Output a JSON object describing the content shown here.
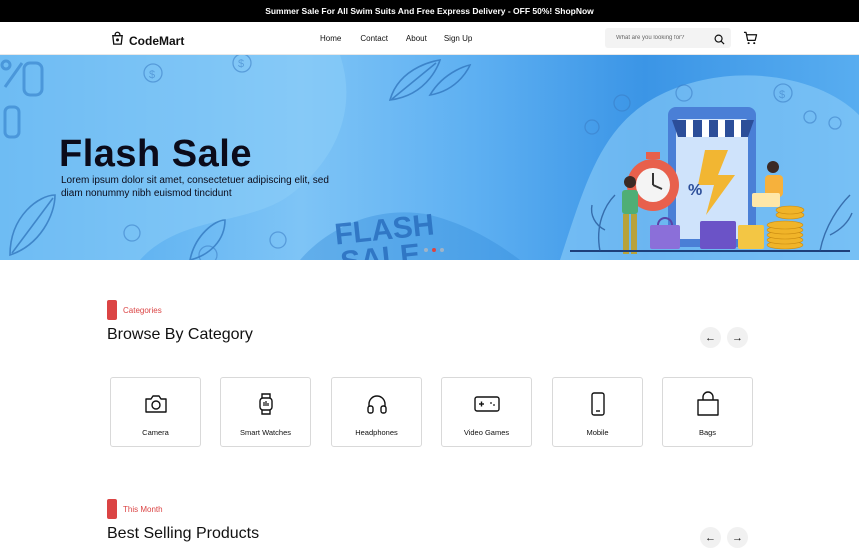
{
  "topbar": {
    "text": "Summer Sale For All Swim Suits And Free Express Delivery - OFF 50%! ShopNow"
  },
  "header": {
    "brand": "CodeMart",
    "nav": [
      "Home",
      "Contact",
      "About",
      "Sign Up"
    ],
    "search_placeholder": "What are you looking for?"
  },
  "hero": {
    "title": "Flash Sale",
    "subtitle": "Lorem ipsum dolor sit amet, consectetuer adipiscing elit, sed diam nonummy nibh euismod tincidunt",
    "illustration_text": "FLASH SALE",
    "active_slide": 2,
    "slides": 3
  },
  "categories": {
    "tag": "Categories",
    "title": "Browse By Category",
    "items": [
      {
        "label": "Camera",
        "icon": "camera-icon"
      },
      {
        "label": "Smart Watches",
        "icon": "smartwatch-icon"
      },
      {
        "label": "Headphones",
        "icon": "headphones-icon"
      },
      {
        "label": "Video Games",
        "icon": "gamepad-icon"
      },
      {
        "label": "Mobile",
        "icon": "phone-icon"
      },
      {
        "label": "Bags",
        "icon": "bag-icon"
      }
    ]
  },
  "best_selling": {
    "tag": "This Month",
    "title": "Best Selling Products"
  },
  "colors": {
    "accent": "#db4444",
    "hero_blue": "#4aa6ee",
    "topbar": "#000000"
  }
}
